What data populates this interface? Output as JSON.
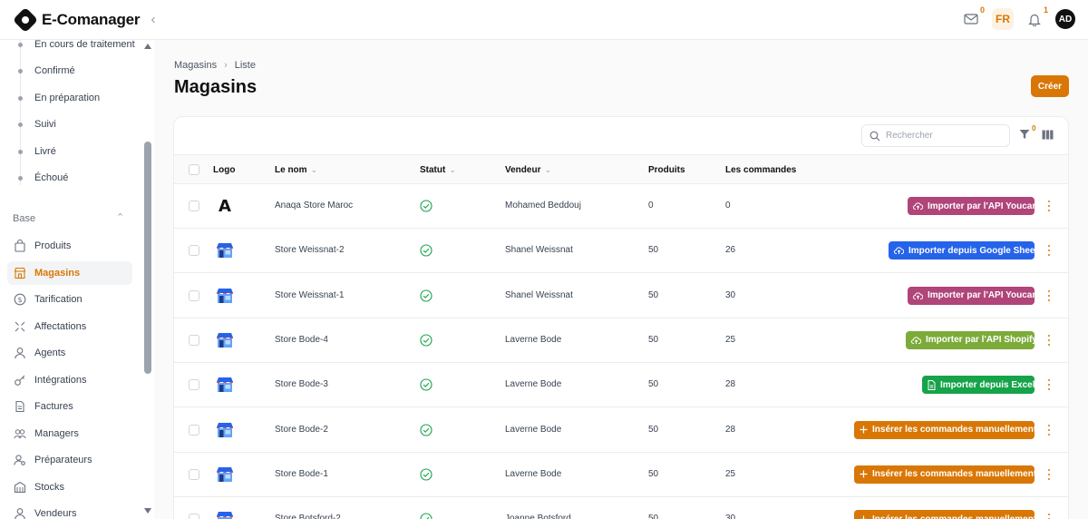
{
  "app": {
    "name": "E-Comanager"
  },
  "header": {
    "mail_badge": "0",
    "lang": "FR",
    "notif_badge": "1",
    "avatar": "AD"
  },
  "sidebar": {
    "sub_items": [
      {
        "label": "En cours de traitement"
      },
      {
        "label": "Confirmé"
      },
      {
        "label": "En préparation"
      },
      {
        "label": "Suivi"
      },
      {
        "label": "Livré"
      },
      {
        "label": "Échoué"
      }
    ],
    "section": "Base",
    "items": [
      {
        "label": "Produits",
        "icon": "bag-icon"
      },
      {
        "label": "Magasins",
        "icon": "store-icon",
        "active": true
      },
      {
        "label": "Tarification",
        "icon": "dollar-icon"
      },
      {
        "label": "Affectations",
        "icon": "assign-icon"
      },
      {
        "label": "Agents",
        "icon": "user-icon"
      },
      {
        "label": "Intégrations",
        "icon": "key-icon"
      },
      {
        "label": "Factures",
        "icon": "invoice-icon"
      },
      {
        "label": "Managers",
        "icon": "users-icon"
      },
      {
        "label": "Préparateurs",
        "icon": "user-cog-icon"
      },
      {
        "label": "Stocks",
        "icon": "warehouse-icon"
      },
      {
        "label": "Vendeurs",
        "icon": "seller-icon"
      }
    ]
  },
  "breadcrumb": {
    "root": "Magasins",
    "current": "Liste"
  },
  "page": {
    "title": "Magasins",
    "create_label": "Créer"
  },
  "toolbar": {
    "search_placeholder": "Rechercher",
    "filter_badge": "0"
  },
  "table": {
    "columns": {
      "logo": "Logo",
      "name": "Le nom",
      "status": "Statut",
      "seller": "Vendeur",
      "products": "Produits",
      "orders": "Les commandes"
    },
    "rows": [
      {
        "logo": "A",
        "name": "Anaqa Store Maroc",
        "seller": "Mohamed Beddouj",
        "products": "0",
        "orders": "0",
        "action": "Importer par l'API Youcan",
        "action_color": "#b0457a",
        "action_icon": "cloud-upload-icon"
      },
      {
        "logo": "store",
        "name": "Store Weissnat-2",
        "seller": "Shanel Weissnat",
        "products": "50",
        "orders": "26",
        "action": "Importer depuis Google Sheet",
        "action_color": "#2563eb",
        "action_icon": "cloud-upload-icon"
      },
      {
        "logo": "store",
        "name": "Store Weissnat-1",
        "seller": "Shanel Weissnat",
        "products": "50",
        "orders": "30",
        "action": "Importer par l'API Youcan",
        "action_color": "#b0457a",
        "action_icon": "cloud-upload-icon"
      },
      {
        "logo": "store",
        "name": "Store Bode-4",
        "seller": "Laverne Bode",
        "products": "50",
        "orders": "25",
        "action": "Importer par l'API Shopify",
        "action_color": "#7cab3a",
        "action_icon": "cloud-upload-icon"
      },
      {
        "logo": "store",
        "name": "Store Bode-3",
        "seller": "Laverne Bode",
        "products": "50",
        "orders": "28",
        "action": "Importer depuis Excel",
        "action_color": "#16a34a",
        "action_icon": "file-icon"
      },
      {
        "logo": "store",
        "name": "Store Bode-2",
        "seller": "Laverne Bode",
        "products": "50",
        "orders": "28",
        "action": "Insérer les commandes manuellement",
        "action_color": "#d97706",
        "action_icon": "plus-icon"
      },
      {
        "logo": "store",
        "name": "Store Bode-1",
        "seller": "Laverne Bode",
        "products": "50",
        "orders": "25",
        "action": "Insérer les commandes manuellement",
        "action_color": "#d97706",
        "action_icon": "plus-icon"
      },
      {
        "logo": "store",
        "name": "Store Botsford-2",
        "seller": "Joanne Botsford",
        "products": "50",
        "orders": "30",
        "action": "Insérer les commandes manuellement",
        "action_color": "#d97706",
        "action_icon": "plus-icon"
      }
    ]
  },
  "colors": {
    "accent": "#d97706",
    "status_ok": "#16a34a"
  }
}
